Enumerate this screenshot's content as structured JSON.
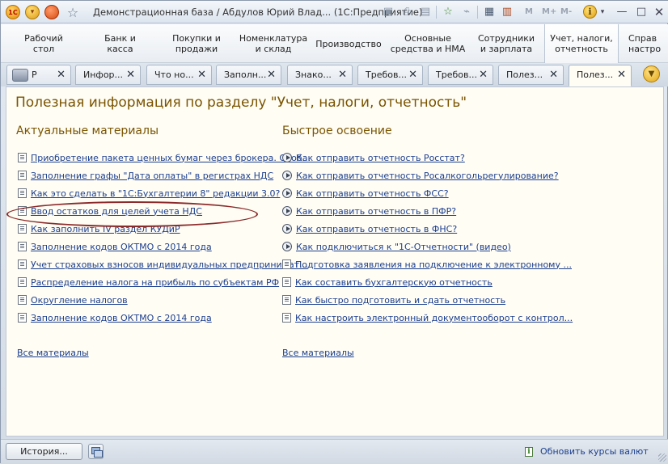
{
  "window": {
    "title": "Демонстрационная база / Абдулов Юрий Влад...  (1С:Предприятие)",
    "toolbar": {
      "m": "M",
      "m_plus": "M+",
      "m_minus": "M-"
    }
  },
  "sections": [
    {
      "label": "Рабочий\nстол"
    },
    {
      "label": "Банк и\nкасса"
    },
    {
      "label": "Покупки и\nпродажи"
    },
    {
      "label": "Номенклатура\nи склад"
    },
    {
      "label": "Производство"
    },
    {
      "label": "Основные\nсредства и НМА"
    },
    {
      "label": "Сотрудники\nи зарплата"
    },
    {
      "label": "Учет, налоги,\nотчетность"
    },
    {
      "label": "Справ\nнастро"
    }
  ],
  "tabs": [
    {
      "label": "Р"
    },
    {
      "label": "Инфор..."
    },
    {
      "label": "Что но..."
    },
    {
      "label": "Заполн..."
    },
    {
      "label": "Знако..."
    },
    {
      "label": "Требов..."
    },
    {
      "label": "Требов..."
    },
    {
      "label": "Полез..."
    },
    {
      "label": "Полез..."
    }
  ],
  "main": {
    "title": "Полезная информация по разделу \"Учет, налоги, отчетность\"",
    "left_column": {
      "title": "Актуальные материалы",
      "items": [
        {
          "label": "Приобретение пакета ценных бумаг через брокера. Особ...",
          "icon": "document-icon"
        },
        {
          "label": "Заполнение графы \"Дата оплаты\"  в регистрах НДС",
          "icon": "document-icon"
        },
        {
          "label": "Как это сделать в \"1С:Бухгалтерии 8\" редакции 3.0?",
          "icon": "document-icon"
        },
        {
          "label": "Ввод остатков для целей учета НДС",
          "icon": "document-icon"
        },
        {
          "label": "Как заполнить IV раздел КУДиР",
          "icon": "document-icon"
        },
        {
          "label": "Заполнение кодов ОКТМО с 2014 года",
          "icon": "document-icon"
        },
        {
          "label": "Учет страховых взносов индивидуальных предпринимат...",
          "icon": "document-icon"
        },
        {
          "label": "Распределение налога на прибыль по субъектам РФ",
          "icon": "document-icon"
        },
        {
          "label": "Округление налогов",
          "icon": "document-icon"
        },
        {
          "label": "Заполнение кодов ОКТМО с 2014 года",
          "icon": "document-icon"
        }
      ],
      "all_link": "Все материалы"
    },
    "right_column": {
      "title": "Быстрое освоение",
      "items": [
        {
          "label": "Как отправить отчетность Росстат?",
          "icon": "play-icon"
        },
        {
          "label": "Как отправить отчетность Росалкогольрегулирование?",
          "icon": "play-icon"
        },
        {
          "label": "Как отправить отчетность ФСС?",
          "icon": "play-icon"
        },
        {
          "label": "Как отправить отчетность в ПФР?",
          "icon": "play-icon"
        },
        {
          "label": "Как отправить отчетность в ФНС?",
          "icon": "play-icon"
        },
        {
          "label": "Как подключиться к \"1С-Отчетности\" (видео)",
          "icon": "play-icon"
        },
        {
          "label": "Подготовка заявления на подключение к электронному ...",
          "icon": "document-icon"
        },
        {
          "label": "Как составить бухгалтерскую отчетность",
          "icon": "document-icon"
        },
        {
          "label": "Как быстро подготовить и сдать отчетность",
          "icon": "document-icon"
        },
        {
          "label": "Как настроить электронный документооборот с контрол...",
          "icon": "document-icon"
        }
      ],
      "all_link": "Все материалы"
    }
  },
  "footer": {
    "history_label": "История...",
    "rates_link": "Обновить курсы валют"
  },
  "colors": {
    "heading": "#7a5400",
    "link": "#1c3f8f",
    "highlight": "#8b2a2a"
  }
}
